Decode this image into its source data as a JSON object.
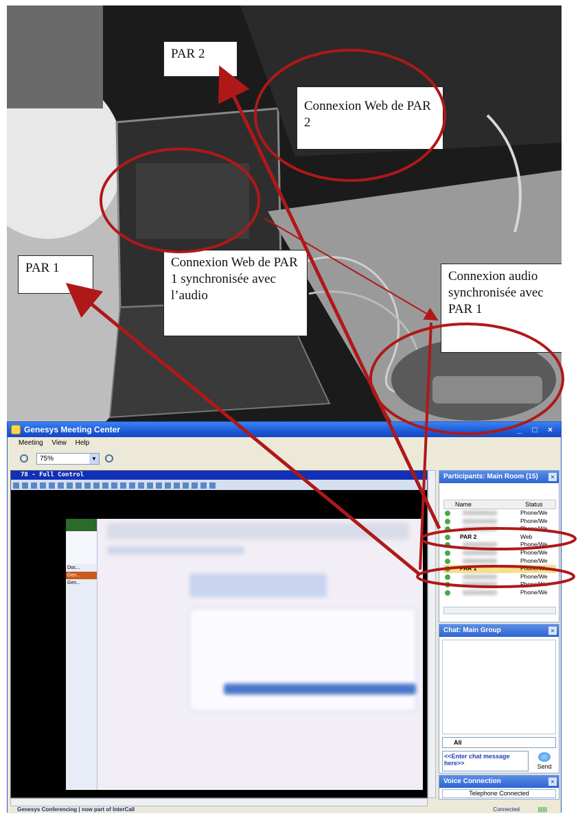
{
  "callouts": {
    "par2": "PAR 2",
    "web_par2": "Connexion Web de PAR 2",
    "par1": "PAR 1",
    "web_par1": "Connexion Web de PAR 1 synchronisée avec l’audio",
    "audio_par1": "Connexion audio synchronisée avec PAR 1"
  },
  "app": {
    "title": "Genesys Meeting Center",
    "window_controls": "_ □ ×",
    "menu": [
      "Meeting",
      "View",
      "Help"
    ],
    "zoom_value": "75%"
  },
  "share": {
    "window_title": "78 - Full Control",
    "sidebar_items": [
      "Doc...",
      "Gen...",
      "Gen..."
    ]
  },
  "participants": {
    "title": "Participants: Main Room (15)",
    "col_name": "Name",
    "col_status": "Status",
    "rows": [
      {
        "name": "",
        "status": "Phone/We",
        "highlight": false
      },
      {
        "name": "",
        "status": "Phone/We",
        "highlight": false
      },
      {
        "name": "",
        "status": "Phone/We",
        "highlight": false
      },
      {
        "name": "PAR 2",
        "status": "Web",
        "highlight": false
      },
      {
        "name": "",
        "status": "Phone/We",
        "highlight": false
      },
      {
        "name": "",
        "status": "Phone/We",
        "highlight": false
      },
      {
        "name": "",
        "status": "Phone/We",
        "highlight": false
      },
      {
        "name": "PAR 1",
        "status": "Phone/We",
        "highlight": true
      },
      {
        "name": "",
        "status": "Phone/We",
        "highlight": false
      },
      {
        "name": "",
        "status": "Phone/We",
        "highlight": false
      },
      {
        "name": "",
        "status": "Phone/We",
        "highlight": false
      }
    ]
  },
  "chat": {
    "title": "Chat: Main Group",
    "to": "All",
    "input_placeholder": "<<Enter chat message here>>",
    "send_label": "Send"
  },
  "voice": {
    "title": "Voice Connection",
    "status": "Telephone Connected"
  },
  "statusbar": {
    "brand": "Genesys Conferencing | now part of InterCall",
    "connection": "Connected",
    "signal": "||||||"
  },
  "colors": {
    "annotation_red": "#b01818",
    "titlebar_blue": "#1c5ad8",
    "highlight_yellow": "#f6e08a"
  }
}
